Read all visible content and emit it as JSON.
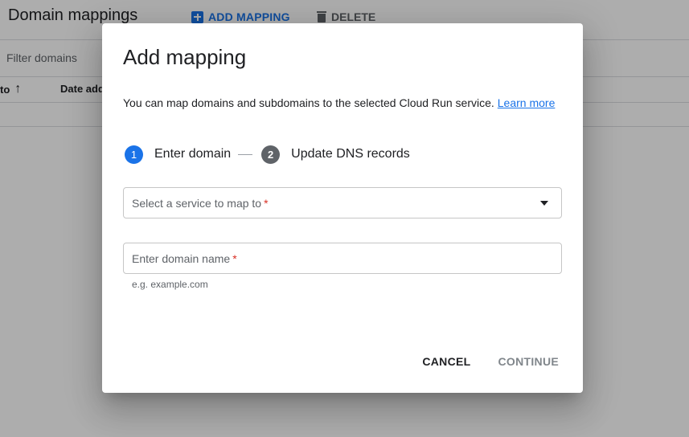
{
  "background": {
    "title": "Domain mappings",
    "add_mapping": "ADD MAPPING",
    "delete": "DELETE",
    "filter_placeholder": "Filter domains",
    "columns": {
      "mapped_to_fragment": "to",
      "date_added_fragment": "Date add"
    }
  },
  "dialog": {
    "title": "Add mapping",
    "description": "You can map domains and subdomains to the selected Cloud Run service.",
    "learn_more": "Learn more",
    "steps": [
      {
        "number": "1",
        "label": "Enter domain",
        "state": "active"
      },
      {
        "number": "2",
        "label": "Update DNS records",
        "state": "inactive"
      }
    ],
    "service_select": {
      "label": "Select a service to map to",
      "required_mark": "*"
    },
    "domain_input": {
      "label": "Enter domain name",
      "required_mark": "*",
      "hint": "e.g. example.com"
    },
    "actions": {
      "cancel": "CANCEL",
      "continue": "CONTINUE"
    }
  },
  "colors": {
    "accent": "#1a73e8",
    "required": "#d93025",
    "disabled_text": "#80868b",
    "scrim": "rgba(0,0,0,0.32)"
  }
}
